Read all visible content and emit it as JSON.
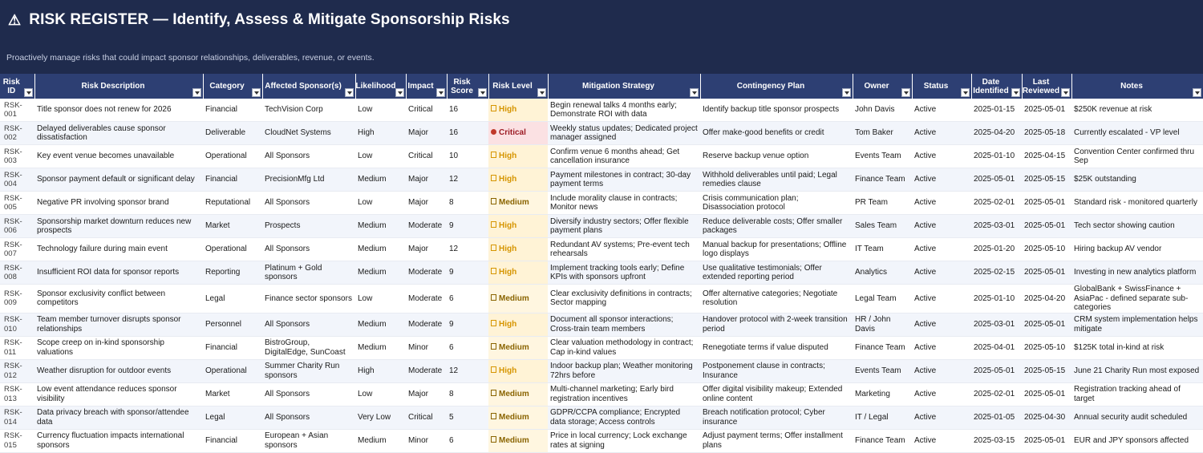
{
  "header": {
    "title": "RISK REGISTER — Identify, Assess & Mitigate Sponsorship Risks",
    "subtitle": "Proactively manage risks that could impact sponsor relationships, deliverables, revenue, or events."
  },
  "columns": [
    "Risk ID",
    "Risk Description",
    "Category",
    "Affected Sponsor(s)",
    "Likelihood",
    "Impact",
    "Risk Score",
    "Risk Level",
    "Mitigation Strategy",
    "Contingency Plan",
    "Owner",
    "Status",
    "Date Identified",
    "Last Reviewed",
    "Notes"
  ],
  "rows": [
    {
      "id": "RSK-001",
      "desc": "Title sponsor does not renew for 2026",
      "category": "Financial",
      "sponsors": "TechVision Corp",
      "likelihood": "Low",
      "impact": "Critical",
      "score": "16",
      "level": "High",
      "mitigation": "Begin renewal talks 4 months early; Demonstrate ROI with data",
      "contingency": "Identify backup title sponsor prospects",
      "owner": "John Davis",
      "status": "Active",
      "identified": "2025-01-15",
      "reviewed": "2025-05-01",
      "notes": "$250K revenue at risk"
    },
    {
      "id": "RSK-002",
      "desc": "Delayed deliverables cause sponsor dissatisfaction",
      "category": "Deliverable",
      "sponsors": "CloudNet Systems",
      "likelihood": "High",
      "impact": "Major",
      "score": "16",
      "level": "Critical",
      "mitigation": "Weekly status updates; Dedicated project manager assigned",
      "contingency": "Offer make-good benefits or credit",
      "owner": "Tom Baker",
      "status": "Active",
      "identified": "2025-04-20",
      "reviewed": "2025-05-18",
      "notes": "Currently escalated - VP level"
    },
    {
      "id": "RSK-003",
      "desc": "Key event venue becomes unavailable",
      "category": "Operational",
      "sponsors": "All Sponsors",
      "likelihood": "Low",
      "impact": "Critical",
      "score": "10",
      "level": "High",
      "mitigation": "Confirm venue 6 months ahead; Get cancellation insurance",
      "contingency": "Reserve backup venue option",
      "owner": "Events Team",
      "status": "Active",
      "identified": "2025-01-10",
      "reviewed": "2025-04-15",
      "notes": "Convention Center confirmed thru Sep"
    },
    {
      "id": "RSK-004",
      "desc": "Sponsor payment default or significant delay",
      "category": "Financial",
      "sponsors": "PrecisionMfg Ltd",
      "likelihood": "Medium",
      "impact": "Major",
      "score": "12",
      "level": "High",
      "mitigation": "Payment milestones in contract; 30-day payment terms",
      "contingency": "Withhold deliverables until paid; Legal remedies clause",
      "owner": "Finance Team",
      "status": "Active",
      "identified": "2025-05-01",
      "reviewed": "2025-05-15",
      "notes": "$25K outstanding"
    },
    {
      "id": "RSK-005",
      "desc": "Negative PR involving sponsor brand",
      "category": "Reputational",
      "sponsors": "All Sponsors",
      "likelihood": "Low",
      "impact": "Major",
      "score": "8",
      "level": "Medium",
      "mitigation": "Include morality clause in contracts; Monitor news",
      "contingency": "Crisis communication plan; Disassociation protocol",
      "owner": "PR Team",
      "status": "Active",
      "identified": "2025-02-01",
      "reviewed": "2025-05-01",
      "notes": "Standard risk - monitored quarterly"
    },
    {
      "id": "RSK-006",
      "desc": "Sponsorship market downturn reduces new prospects",
      "category": "Market",
      "sponsors": "Prospects",
      "likelihood": "Medium",
      "impact": "Moderate",
      "score": "9",
      "level": "High",
      "mitigation": "Diversify industry sectors; Offer flexible payment plans",
      "contingency": "Reduce deliverable costs; Offer smaller packages",
      "owner": "Sales Team",
      "status": "Active",
      "identified": "2025-03-01",
      "reviewed": "2025-05-01",
      "notes": "Tech sector showing caution"
    },
    {
      "id": "RSK-007",
      "desc": "Technology failure during main event",
      "category": "Operational",
      "sponsors": "All Sponsors",
      "likelihood": "Medium",
      "impact": "Major",
      "score": "12",
      "level": "High",
      "mitigation": "Redundant AV systems; Pre-event tech rehearsals",
      "contingency": "Manual backup for presentations; Offline logo displays",
      "owner": "IT Team",
      "status": "Active",
      "identified": "2025-01-20",
      "reviewed": "2025-05-10",
      "notes": "Hiring backup AV vendor"
    },
    {
      "id": "RSK-008",
      "desc": "Insufficient ROI data for sponsor reports",
      "category": "Reporting",
      "sponsors": "Platinum + Gold sponsors",
      "likelihood": "Medium",
      "impact": "Moderate",
      "score": "9",
      "level": "High",
      "mitigation": "Implement tracking tools early; Define KPIs with sponsors upfront",
      "contingency": "Use qualitative testimonials; Offer extended reporting period",
      "owner": "Analytics",
      "status": "Active",
      "identified": "2025-02-15",
      "reviewed": "2025-05-01",
      "notes": "Investing in new analytics platform"
    },
    {
      "id": "RSK-009",
      "desc": "Sponsor exclusivity conflict between competitors",
      "category": "Legal",
      "sponsors": "Finance sector sponsors",
      "likelihood": "Low",
      "impact": "Moderate",
      "score": "6",
      "level": "Medium",
      "mitigation": "Clear exclusivity definitions in contracts; Sector mapping",
      "contingency": "Offer alternative categories; Negotiate resolution",
      "owner": "Legal Team",
      "status": "Active",
      "identified": "2025-01-10",
      "reviewed": "2025-04-20",
      "notes": "GlobalBank + SwissFinance + AsiaPac - defined separate sub-categories"
    },
    {
      "id": "RSK-010",
      "desc": "Team member turnover disrupts sponsor relationships",
      "category": "Personnel",
      "sponsors": "All Sponsors",
      "likelihood": "Medium",
      "impact": "Moderate",
      "score": "9",
      "level": "High",
      "mitigation": "Document all sponsor interactions; Cross-train team members",
      "contingency": "Handover protocol with 2-week transition period",
      "owner": "HR / John Davis",
      "status": "Active",
      "identified": "2025-03-01",
      "reviewed": "2025-05-01",
      "notes": "CRM system implementation helps mitigate"
    },
    {
      "id": "RSK-011",
      "desc": "Scope creep on in-kind sponsorship valuations",
      "category": "Financial",
      "sponsors": "BistroGroup, DigitalEdge, SunCoast",
      "likelihood": "Medium",
      "impact": "Minor",
      "score": "6",
      "level": "Medium",
      "mitigation": "Clear valuation methodology in contract; Cap in-kind values",
      "contingency": "Renegotiate terms if value disputed",
      "owner": "Finance Team",
      "status": "Active",
      "identified": "2025-04-01",
      "reviewed": "2025-05-10",
      "notes": "$125K total in-kind at risk"
    },
    {
      "id": "RSK-012",
      "desc": "Weather disruption for outdoor events",
      "category": "Operational",
      "sponsors": "Summer Charity Run sponsors",
      "likelihood": "High",
      "impact": "Moderate",
      "score": "12",
      "level": "High",
      "mitigation": "Indoor backup plan; Weather monitoring 72hrs before",
      "contingency": "Postponement clause in contracts; Insurance",
      "owner": "Events Team",
      "status": "Active",
      "identified": "2025-05-01",
      "reviewed": "2025-05-15",
      "notes": "June 21 Charity Run most exposed"
    },
    {
      "id": "RSK-013",
      "desc": "Low event attendance reduces sponsor visibility",
      "category": "Market",
      "sponsors": "All Sponsors",
      "likelihood": "Low",
      "impact": "Major",
      "score": "8",
      "level": "Medium",
      "mitigation": "Multi-channel marketing; Early bird registration incentives",
      "contingency": "Offer digital visibility makeup; Extended online content",
      "owner": "Marketing",
      "status": "Active",
      "identified": "2025-02-01",
      "reviewed": "2025-05-01",
      "notes": "Registration tracking ahead of target"
    },
    {
      "id": "RSK-014",
      "desc": "Data privacy breach with sponsor/attendee data",
      "category": "Legal",
      "sponsors": "All Sponsors",
      "likelihood": "Very Low",
      "impact": "Critical",
      "score": "5",
      "level": "Medium",
      "mitigation": "GDPR/CCPA compliance; Encrypted data storage; Access controls",
      "contingency": "Breach notification protocol; Cyber insurance",
      "owner": "IT / Legal",
      "status": "Active",
      "identified": "2025-01-05",
      "reviewed": "2025-04-30",
      "notes": "Annual security audit scheduled"
    },
    {
      "id": "RSK-015",
      "desc": "Currency fluctuation impacts international sponsors",
      "category": "Financial",
      "sponsors": "European + Asian sponsors",
      "likelihood": "Medium",
      "impact": "Minor",
      "score": "6",
      "level": "Medium",
      "mitigation": "Price in local currency; Lock exchange rates at signing",
      "contingency": "Adjust payment terms; Offer installment plans",
      "owner": "Finance Team",
      "status": "Active",
      "identified": "2025-03-15",
      "reviewed": "2025-05-01",
      "notes": "EUR and JPY sponsors affected"
    }
  ]
}
